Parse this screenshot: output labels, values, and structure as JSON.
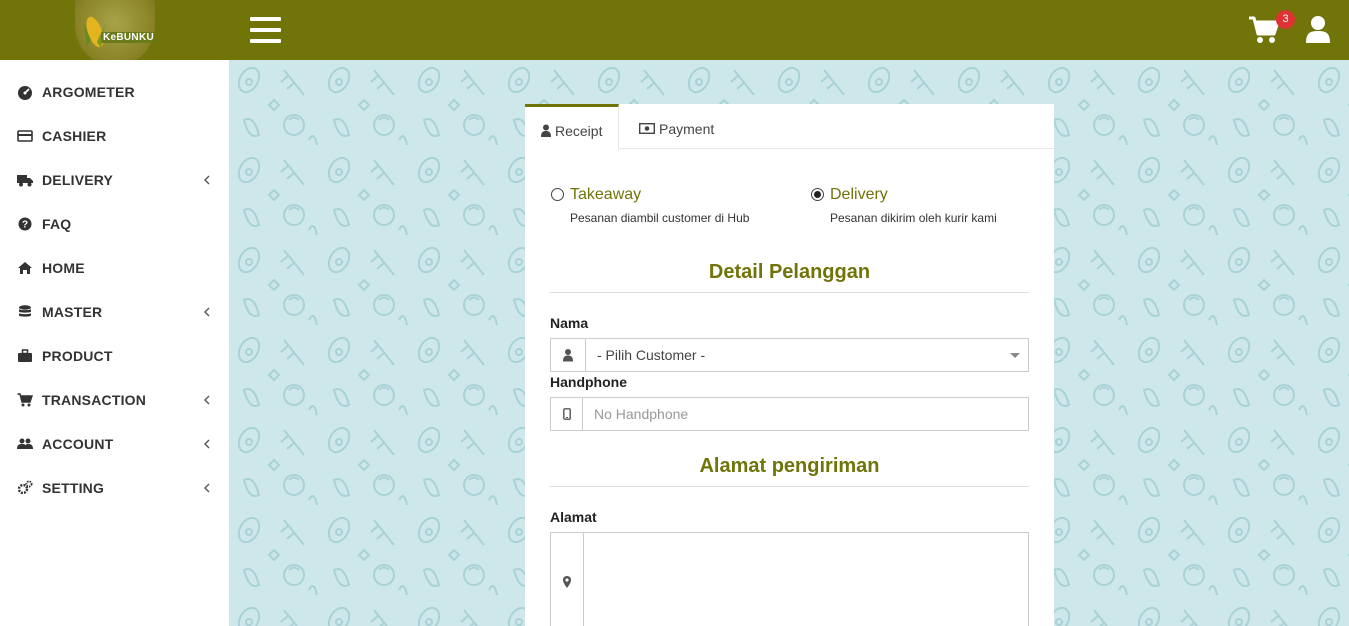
{
  "brand": {
    "logo_text": "KeBUNKU",
    "primary_color": "#707409",
    "content_bg": "#cde7ea"
  },
  "header": {
    "cart_count": "3",
    "menu_icon": "hamburger-icon",
    "cart_icon": "cart-icon",
    "user_icon": "user-icon"
  },
  "sidebar": {
    "items": [
      {
        "label": "ARGOMETER",
        "icon": "dashboard-icon",
        "has_submenu": false
      },
      {
        "label": "CASHIER",
        "icon": "credit-card-icon",
        "has_submenu": false
      },
      {
        "label": "DELIVERY",
        "icon": "truck-icon",
        "has_submenu": true
      },
      {
        "label": "FAQ",
        "icon": "question-circle-icon",
        "has_submenu": false
      },
      {
        "label": "HOME",
        "icon": "home-icon",
        "has_submenu": false
      },
      {
        "label": "MASTER",
        "icon": "database-icon",
        "has_submenu": true
      },
      {
        "label": "PRODUCT",
        "icon": "briefcase-icon",
        "has_submenu": false
      },
      {
        "label": "TRANSACTION",
        "icon": "shopping-cart-icon",
        "has_submenu": true
      },
      {
        "label": "ACCOUNT",
        "icon": "users-icon",
        "has_submenu": true
      },
      {
        "label": "SETTING",
        "icon": "cogs-icon",
        "has_submenu": true
      }
    ]
  },
  "tabs": [
    {
      "label": "Receipt",
      "icon": "user-icon",
      "active": true
    },
    {
      "label": "Payment",
      "icon": "money-icon",
      "active": false
    }
  ],
  "order_type": {
    "options": [
      {
        "title": "Takeaway",
        "description": "Pesanan diambil customer di Hub",
        "checked": false
      },
      {
        "title": "Delivery",
        "description": "Pesanan dikirim oleh kurir kami",
        "checked": true
      }
    ]
  },
  "customer_section": {
    "title": "Detail Pelanggan",
    "name_label": "Nama",
    "name_value": "- Pilih Customer -",
    "phone_label": "Handphone",
    "phone_placeholder": "No Handphone"
  },
  "address_section": {
    "title": "Alamat pengiriman",
    "address_label": "Alamat",
    "address_value": ""
  }
}
